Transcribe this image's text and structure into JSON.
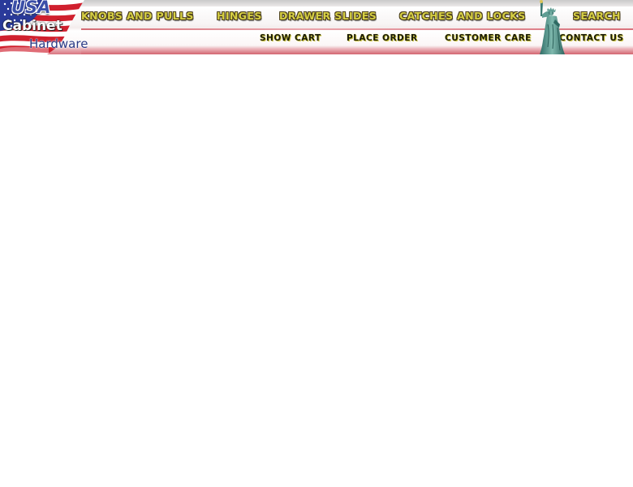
{
  "logo": {
    "line1": "USA",
    "line2": "Cabinet",
    "line3": "Hardware"
  },
  "nav": {
    "primary": [
      {
        "label": "KNOBS AND PULLS"
      },
      {
        "label": "HINGES"
      },
      {
        "label": "DRAWER SLIDES"
      },
      {
        "label": "CATCHES AND LOCKS"
      },
      {
        "label": "SEARCH"
      }
    ],
    "secondary": [
      {
        "label": "SHOW CART"
      },
      {
        "label": "PLACE ORDER"
      },
      {
        "label": "CUSTOMER CARE"
      },
      {
        "label": "CONTACT US"
      }
    ]
  },
  "icons": {
    "logo_flag": "us-flag-icon",
    "statue": "statue-of-liberty-icon"
  },
  "colors": {
    "flag_red": "#d0202e",
    "flag_blue": "#2a3a9a",
    "nav_yellow": "#d6cf44",
    "header_pink": "#d9747f"
  }
}
